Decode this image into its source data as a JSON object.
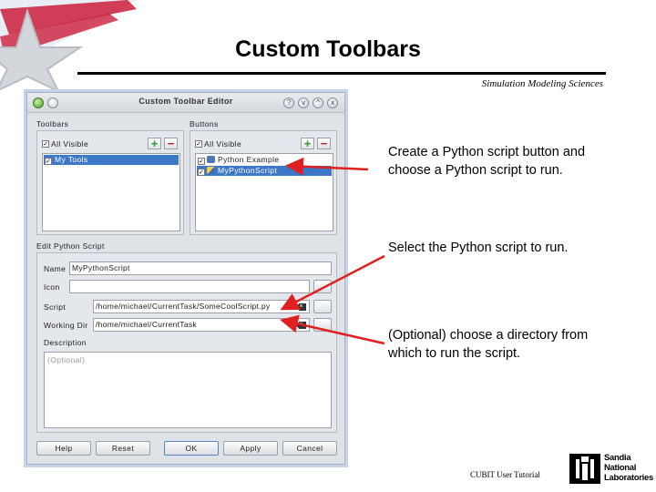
{
  "slide": {
    "title": "Custom Toolbars",
    "subtitle": "Simulation Modeling Sciences",
    "footer": "CUBIT User Tutorial",
    "logo_lines": [
      "Sandia",
      "National",
      "Laboratories"
    ]
  },
  "dialog": {
    "title": "Custom Toolbar Editor",
    "window_buttons": [
      "?",
      "v",
      "^",
      "x"
    ],
    "toolbars": {
      "label": "Toolbars",
      "all_visible_label": "All Visible",
      "items": [
        {
          "label": "My Tools",
          "checked": true,
          "selected": true
        }
      ]
    },
    "buttons": {
      "label": "Buttons",
      "all_visible_label": "All Visible",
      "items": [
        {
          "label": "Python Example",
          "checked": true,
          "selected": false
        },
        {
          "label": "MyPythonScript",
          "checked": true,
          "selected": true
        }
      ]
    },
    "edit": {
      "label": "Edit Python Script",
      "name_label": "Name",
      "name_value": "MyPythonScript",
      "icon_label": "Icon",
      "icon_value": "",
      "script_label": "Script",
      "script_value": "/home/michael/CurrentTask/SomeCoolScript.py",
      "working_dir_label": "Working Dir",
      "working_dir_value": "/home/michael/CurrentTask",
      "description_label": "Description",
      "description_placeholder": "(Optional)"
    },
    "footer_buttons": {
      "help": "Help",
      "reset": "Reset",
      "ok": "OK",
      "apply": "Apply",
      "cancel": "Cancel"
    }
  },
  "notes": [
    "Create a Python script button and choose a Python script to run.",
    "Select the Python script to run.",
    "(Optional) choose a directory from which to run the script."
  ],
  "colors": {
    "selection": "#3d77c7",
    "arrow": "#e02020",
    "plus": "#2c9a2c",
    "minus": "#c22222"
  }
}
